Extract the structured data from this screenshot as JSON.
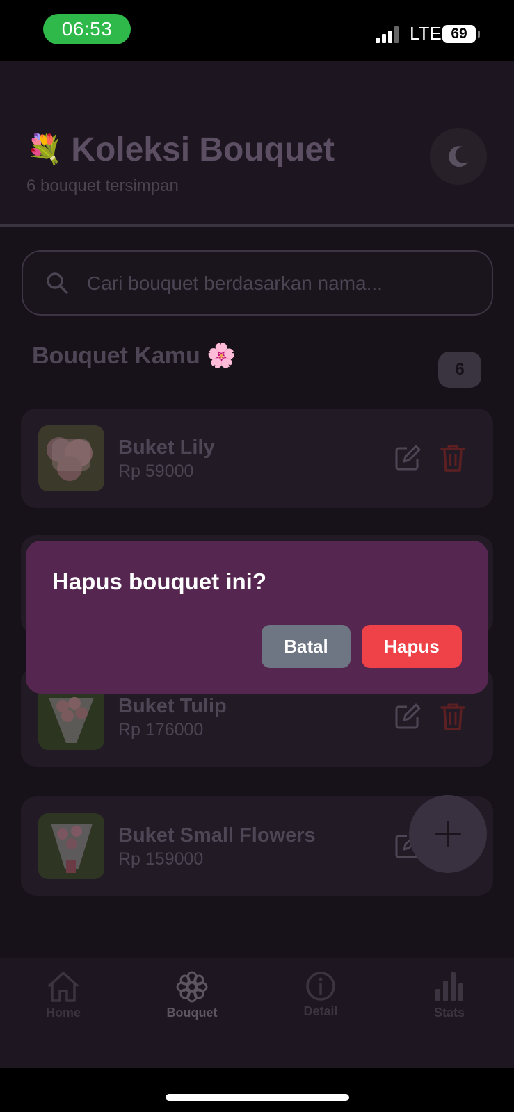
{
  "status_bar": {
    "time": "06:53",
    "network": "LTE",
    "battery": "69"
  },
  "header": {
    "emoji": "💐",
    "title": "Koleksi Bouquet",
    "subtitle": "6 bouquet tersimpan",
    "theme_icon": "moon-icon"
  },
  "search": {
    "placeholder": "Cari bouquet berdasarkan nama..."
  },
  "section": {
    "title": "Bouquet Kamu 🌸",
    "count": "6"
  },
  "bouquets": [
    {
      "name": "Buket Lily",
      "price": "Rp 59000"
    },
    {
      "name": "Buket Tulip",
      "price": "Rp 176000"
    },
    {
      "name": "Buket Small Flowers",
      "price": "Rp 159000"
    }
  ],
  "dialog": {
    "title": "Hapus bouquet ini?",
    "cancel_label": "Batal",
    "delete_label": "Hapus"
  },
  "tabs": [
    {
      "label": "Home",
      "icon": "home-icon",
      "active": false
    },
    {
      "label": "Bouquet",
      "icon": "flower-icon",
      "active": true
    },
    {
      "label": "Detail",
      "icon": "info-icon",
      "active": false
    },
    {
      "label": "Stats",
      "icon": "bar-chart-icon",
      "active": false
    }
  ],
  "colors": {
    "background": "#17121a",
    "dialog": "#55264f",
    "cancel_button": "#6e7683",
    "delete_button": "#ee4248",
    "status_time_pill": "#2fb94a"
  }
}
